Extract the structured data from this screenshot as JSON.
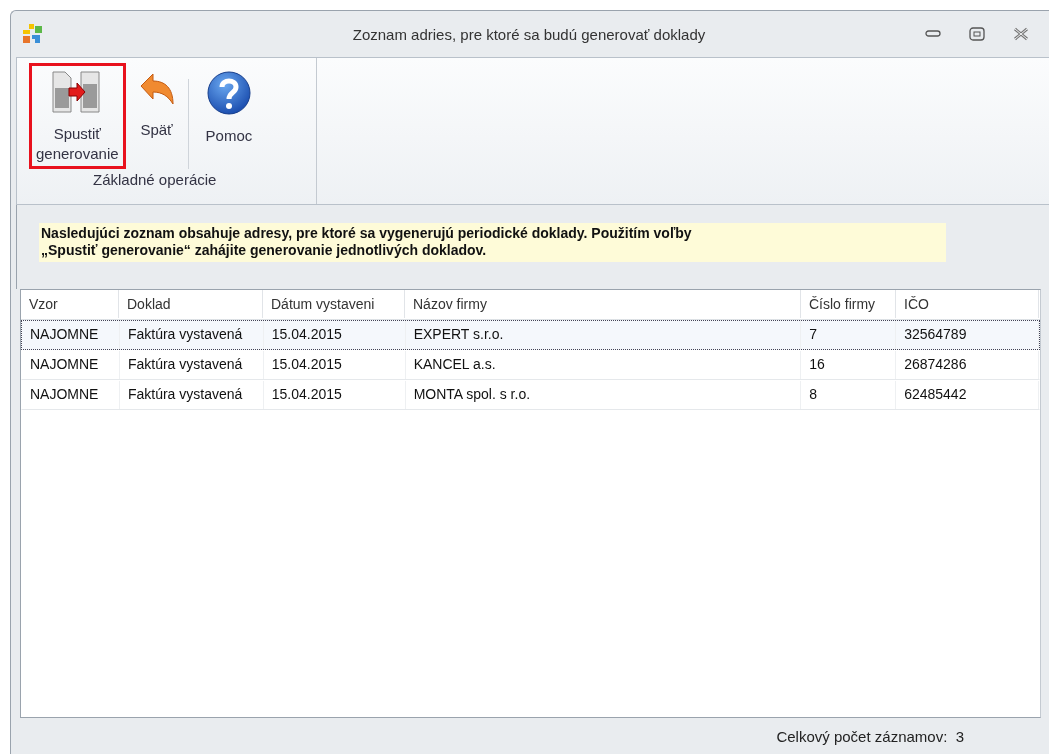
{
  "window": {
    "title": "Zoznam adries, pre ktoré sa budú generovať doklady"
  },
  "ribbon": {
    "group_label": "Základné operácie",
    "buttons": [
      {
        "kind": "generate",
        "label_lines": [
          "Spustiť",
          "generovanie"
        ],
        "highlighted": true
      },
      {
        "kind": "back",
        "label_lines": [
          "Späť"
        ],
        "highlighted": false
      },
      {
        "kind": "help",
        "label_lines": [
          "Pomoc"
        ],
        "highlighted": false
      }
    ]
  },
  "info": {
    "lines": [
      "Nasledujúci zoznam obsahuje adresy, pre ktoré sa vygenerujú periodické doklady. Použitím voľby",
      "„Spustiť generovanie“ zahájite generovanie jednotlivých dokladov."
    ]
  },
  "table": {
    "columns": [
      "Vzor",
      "Doklad",
      "Dátum vystaveni",
      "Názov firmy",
      "Číslo firmy",
      "IČO"
    ],
    "rows": [
      {
        "selected": true,
        "cells": [
          "NAJOMNE",
          "Faktúra vystavená",
          "15.04.2015",
          "EXPERT s.r.o.",
          "7",
          "32564789"
        ]
      },
      {
        "selected": false,
        "cells": [
          "NAJOMNE",
          "Faktúra vystavená",
          "15.04.2015",
          "KANCEL a.s.",
          "16",
          "26874286"
        ]
      },
      {
        "selected": false,
        "cells": [
          "NAJOMNE",
          "Faktúra vystavená",
          "15.04.2015",
          "MONTA spol. s r.o.",
          "8",
          "62485442"
        ]
      }
    ]
  },
  "status_bar": {
    "text": "Celkový počet záznamov:  3"
  }
}
